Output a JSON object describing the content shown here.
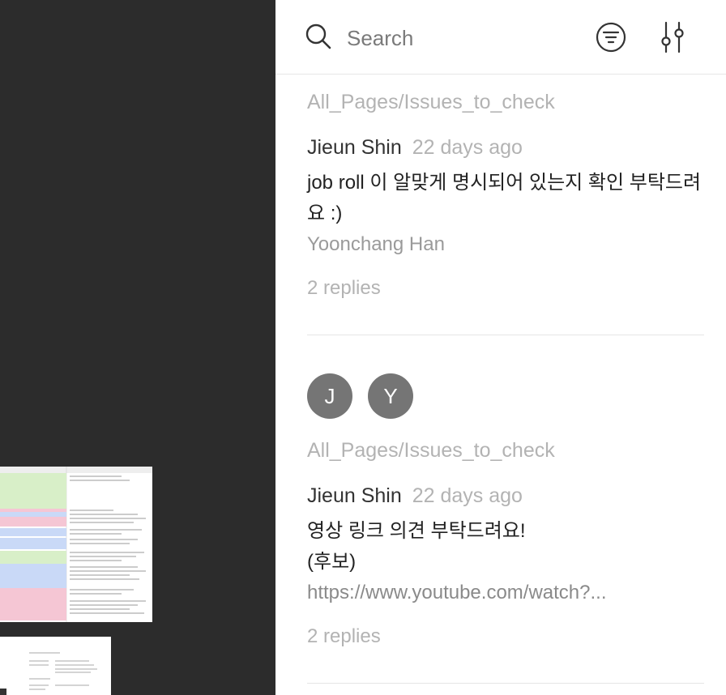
{
  "search": {
    "placeholder": "Search"
  },
  "threads": [
    {
      "page_path": "All_Pages/Issues_to_check",
      "author": "Jieun Shin",
      "time": "22 days ago",
      "comment": "job roll 이 알맞게 명시되어 있는지 확인 부탁드려요 :)",
      "mention": "Yoonchang Han",
      "replies": "2 replies"
    },
    {
      "avatars": [
        "J",
        "Y"
      ],
      "page_path": "All_Pages/Issues_to_check",
      "author": "Jieun Shin",
      "time": "22 days ago",
      "comment_line1": "영상 링크 의견 부탁드려요!",
      "comment_line2": "(후보)",
      "link": "https://www.youtube.com/watch?...",
      "replies": "2 replies"
    }
  ],
  "icons": [
    "search-icon",
    "filter-icon",
    "sliders-icon"
  ]
}
